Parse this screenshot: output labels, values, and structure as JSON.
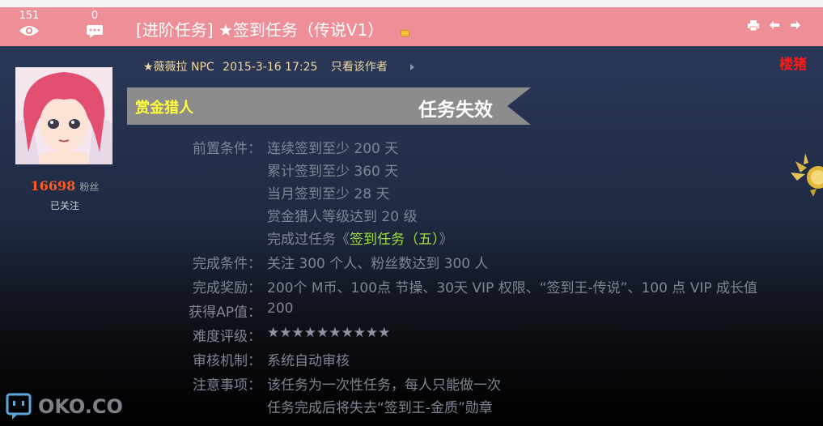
{
  "header": {
    "views": "151",
    "replies": "0",
    "title": "[进阶任务] ★签到任务（传说V1）"
  },
  "post": {
    "author": "★薇薇拉 NPC",
    "datetime": "2015-3-16 17:25",
    "only_author": "只看该作者",
    "floor": "楼猪",
    "fans_count": "16698",
    "fans_label": "粉丝",
    "follow_status": "已关注"
  },
  "banner": {
    "left": "赏金猎人",
    "right": "任务失效"
  },
  "task": {
    "pre_label": "前置条件：",
    "pre_1": "连续签到至少 200 天",
    "pre_2": "累计签到至少 360 天",
    "pre_3": "当月签到至少 28 天",
    "pre_4": "赏金猎人等级达到 20 级",
    "pre_5_prefix": "完成过任务《",
    "pre_5_link": "签到任务（五）",
    "pre_5_suffix": "》",
    "done_label": "完成条件：",
    "done_value": "关注 300 个人、粉丝数达到 300 人",
    "reward_label": "完成奖励：",
    "reward_value": "200个 M币、100点 节操、30天 VIP 权限、“签到王-传说”、100 点 VIP 成长值",
    "ap_label": "获得AP值：",
    "ap_value": "200",
    "difficulty_label": "难度评级：",
    "difficulty_value": "★★★★★★★★★★",
    "review_label": "审核机制：",
    "review_value": "系统自动审核",
    "note_label": "注意事项：",
    "note_1": "该任务为一次性任务，每人只能做一次",
    "note_2": "任务完成后将失去“签到王-金质”勋章"
  },
  "watermark": "OKO.CO",
  "colors": {
    "header_bg": "#ee8f97",
    "panel_top": "#2a3758",
    "fans": "#ff5a1e",
    "floor": "#ff1a1a",
    "banner_gray": "#8c8c8c",
    "hunter_yellow": "#ffff3a",
    "link_green": "#9fe040"
  }
}
